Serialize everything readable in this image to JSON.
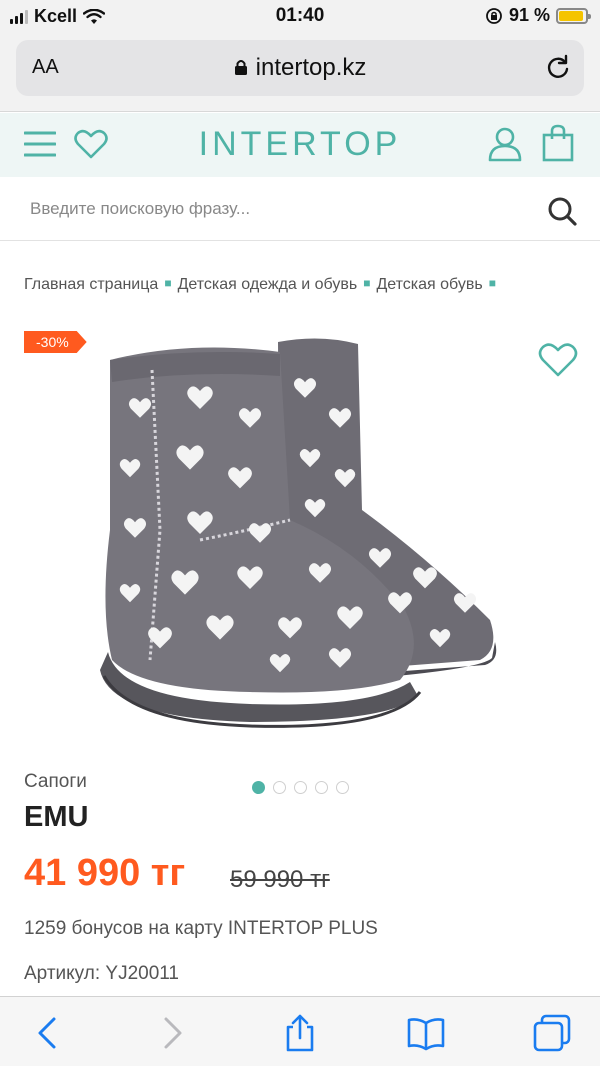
{
  "status_bar": {
    "carrier": "Kcell",
    "time": "01:40",
    "battery_percent": "91 %",
    "battery_level": 0.91
  },
  "browser": {
    "text_size_label": "AA",
    "url": "intertop.kz"
  },
  "site": {
    "logo": "INTERTOP",
    "accent_color": "#4fb3a6",
    "sale_color": "#ff5a1f"
  },
  "search": {
    "placeholder": "Введите поисковую фразу..."
  },
  "breadcrumb": {
    "items": [
      "Главная страница",
      "Детская одежда и обувь",
      "Детская обувь"
    ]
  },
  "product": {
    "discount": "-30%",
    "category": "Сапоги",
    "brand": "EMU",
    "price": "41 990 тг",
    "old_price": "59 990 тг",
    "bonus_text": "1259 бонусов на карту INTERTOP PLUS",
    "article": "Артикул: YJ20011",
    "gallery_total": 5,
    "gallery_active": 1
  },
  "icons": {
    "menu": "menu-icon",
    "wishlist": "heart-icon",
    "user": "user-icon",
    "cart": "bag-icon",
    "search": "search-icon"
  }
}
